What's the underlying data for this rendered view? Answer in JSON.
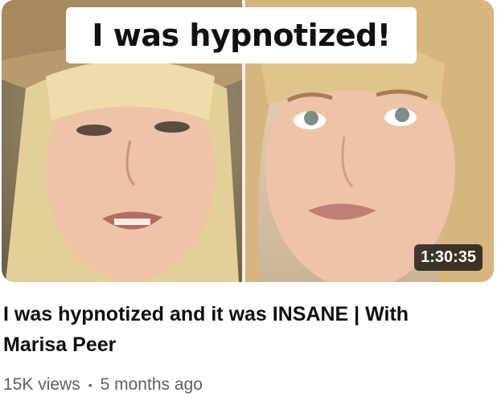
{
  "thumbnail": {
    "caption": "I was hypnotized!",
    "duration": "1:30:35"
  },
  "video": {
    "title": "I was hypnotized and it was INSANE | With Marisa Peer",
    "views": "15K views",
    "separator": "•",
    "age": "5 months ago"
  }
}
